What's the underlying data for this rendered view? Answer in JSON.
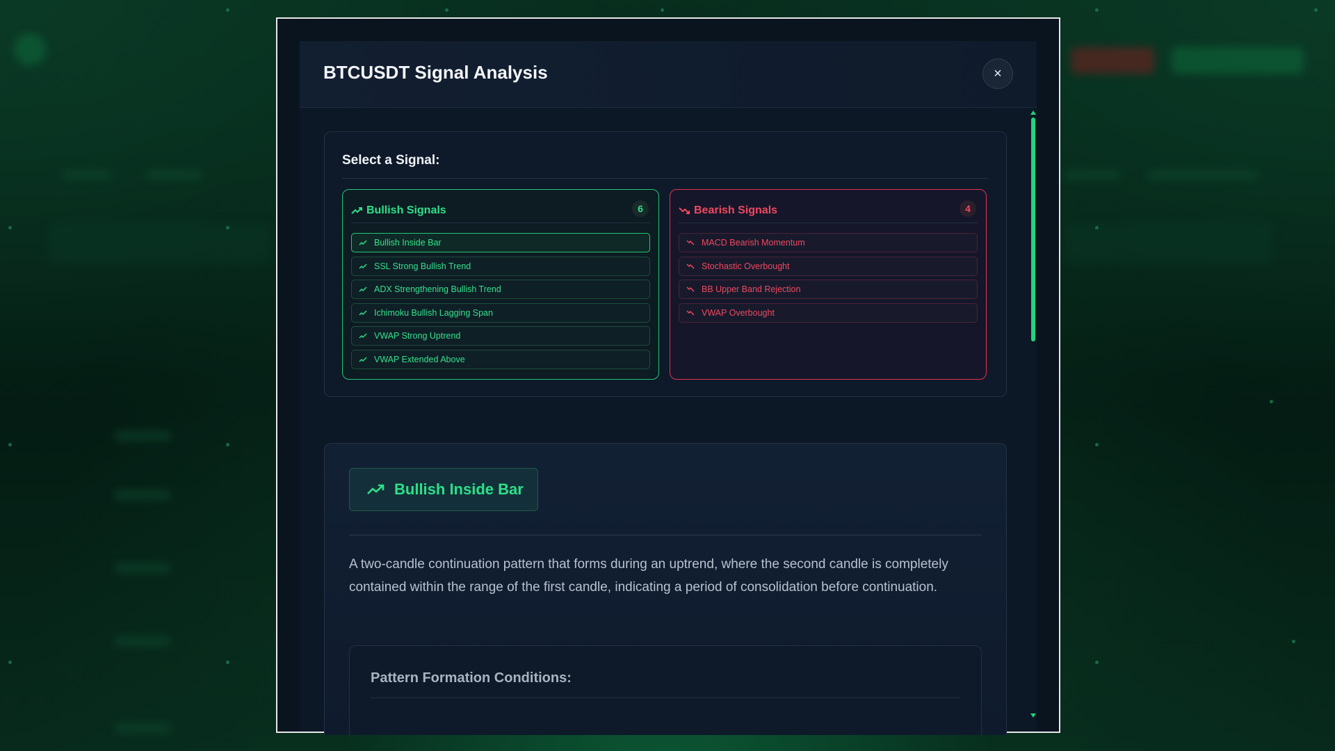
{
  "modal": {
    "title": "BTCUSDT Signal Analysis",
    "close_label": "×"
  },
  "selector": {
    "title": "Select a Signal:",
    "bullish": {
      "label": "Bullish Signals",
      "count": "6",
      "items": [
        "Bullish Inside Bar",
        "SSL Strong Bullish Trend",
        "ADX Strengthening Bullish Trend",
        "Ichimoku Bullish Lagging Span",
        "VWAP Strong Uptrend",
        "VWAP Extended Above"
      ]
    },
    "bearish": {
      "label": "Bearish Signals",
      "count": "4",
      "items": [
        "MACD Bearish Momentum",
        "Stochastic Overbought",
        "BB Upper Band Rejection",
        "VWAP Overbought"
      ]
    }
  },
  "detail": {
    "name": "Bullish Inside Bar",
    "description": "A two-candle continuation pattern that forms during an uptrend, where the second candle is completely contained within the range of the first candle, indicating a period of consolidation before continuation.",
    "conditions_title": "Pattern Formation Conditions:"
  },
  "colors": {
    "bullish": "#2de088",
    "bearish": "#f0485f",
    "background": "#0d1826"
  },
  "icons": {
    "bullish": "trending-up-icon",
    "bearish": "trending-down-icon",
    "close": "close-icon"
  }
}
